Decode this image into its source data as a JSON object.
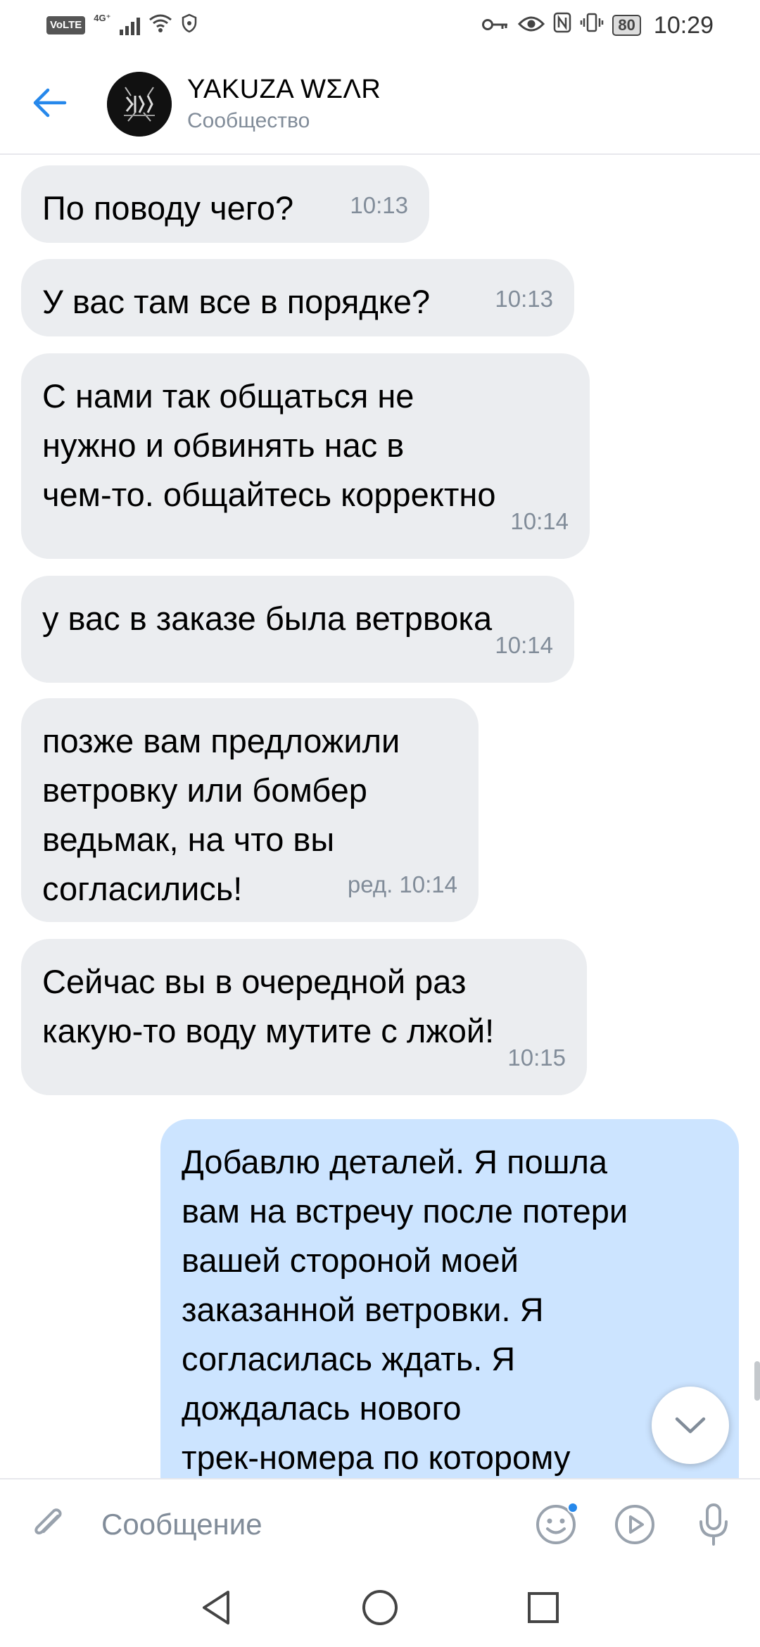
{
  "status_bar": {
    "volte": "VoLTE",
    "network": "4G⁺",
    "battery": "80",
    "time": "10:29"
  },
  "header": {
    "title": "YAKUZA WΣΛR",
    "subtitle": "Сообщество",
    "back_icon": "arrow-left-icon",
    "avatar": "community-logo"
  },
  "messages": [
    {
      "direction": "incoming",
      "text": "По поводу чего?",
      "time": "10:13"
    },
    {
      "direction": "incoming",
      "text": "У вас там все в порядке?",
      "time": "10:13"
    },
    {
      "direction": "incoming",
      "text": "С нами так общаться не\nнужно и обвинять нас в\nчем-то. общайтесь корректно",
      "time": "10:14"
    },
    {
      "direction": "incoming",
      "text": "у вас в заказе была ветрвока",
      "time": "10:14"
    },
    {
      "direction": "incoming",
      "text": "позже вам предложили\nветровку или бомбер\nведьмак, на что вы\nсогласились!",
      "time": "ред. 10:14"
    },
    {
      "direction": "incoming",
      "text": "Сейчас вы в очередной раз\nкакую-то воду мутите с лжой!",
      "time": "10:15"
    },
    {
      "direction": "outgoing",
      "text": "Добавлю деталей. Я пошла\nвам на встречу после потери\nвашей стороной моей\nзаказанной ветровки. Я\nсогласилась ждать. Я\nдождалась нового\nтрек-номера по которому",
      "time": ""
    }
  ],
  "composer": {
    "placeholder": "Сообщение",
    "attach_icon": "paperclip-icon",
    "emoji_icon": "smile-icon",
    "video_icon": "play-circle-icon",
    "mic_icon": "microphone-icon"
  },
  "colors": {
    "incoming_bubble": "#ebedf0",
    "outgoing_bubble": "#cce4ff",
    "accent": "#2688eb",
    "secondary_text": "#818c99"
  }
}
